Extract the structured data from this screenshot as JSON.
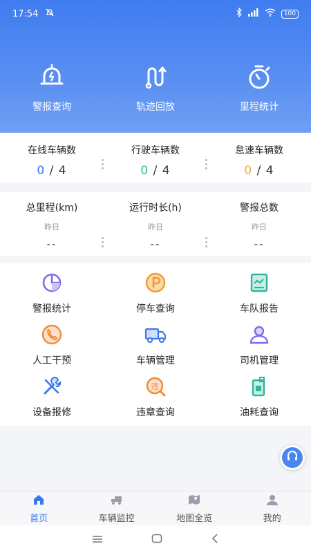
{
  "status_bar": {
    "time": "17:54",
    "battery": "100"
  },
  "quick_actions": [
    {
      "label": "警报查询",
      "icon": "alarm-bell-icon"
    },
    {
      "label": "轨迹回放",
      "icon": "route-icon"
    },
    {
      "label": "里程统计",
      "icon": "stopwatch-icon"
    }
  ],
  "vehicle_stats": [
    {
      "title": "在线车辆数",
      "current": "0",
      "separator": "/",
      "total": "4",
      "color": "#3b78ea"
    },
    {
      "title": "行驶车辆数",
      "current": "0",
      "separator": "/",
      "total": "4",
      "color": "#2fb59a"
    },
    {
      "title": "怠速车辆数",
      "current": "0",
      "separator": "/",
      "total": "4",
      "color": "#f2a73a"
    }
  ],
  "daily_stats": [
    {
      "title": "总里程(km)",
      "sub": "昨日",
      "value": "--"
    },
    {
      "title": "运行时长(h)",
      "sub": "昨日",
      "value": "--"
    },
    {
      "title": "警报总数",
      "sub": "昨日",
      "value": "--"
    }
  ],
  "grid_items": [
    {
      "label": "警报统计",
      "icon": "pie-chart-icon"
    },
    {
      "label": "停车查询",
      "icon": "parking-icon"
    },
    {
      "label": "车队报告",
      "icon": "report-icon"
    },
    {
      "label": "人工干预",
      "icon": "phone-icon"
    },
    {
      "label": "车辆管理",
      "icon": "truck-icon"
    },
    {
      "label": "司机管理",
      "icon": "driver-icon"
    },
    {
      "label": "设备报修",
      "icon": "tools-icon"
    },
    {
      "label": "违章查询",
      "icon": "violation-icon"
    },
    {
      "label": "油耗查询",
      "icon": "fuel-icon"
    }
  ],
  "tabs": [
    {
      "label": "首页",
      "icon": "home-icon",
      "active": true
    },
    {
      "label": "车辆监控",
      "icon": "truck-icon",
      "active": false
    },
    {
      "label": "地图全览",
      "icon": "map-icon",
      "active": false
    },
    {
      "label": "我的",
      "icon": "user-icon",
      "active": false
    }
  ],
  "colors": {
    "brand": "#3f7cf0",
    "accent_orange": "#f28a2e",
    "accent_purple": "#7b6ee8",
    "accent_teal": "#2fb59a"
  }
}
